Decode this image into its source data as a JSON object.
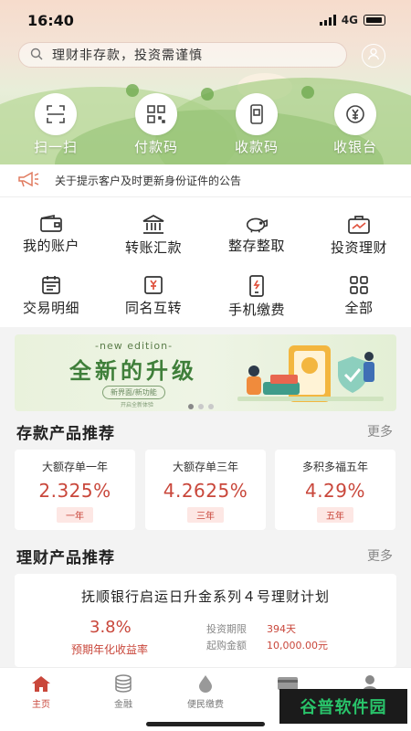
{
  "status_bar": {
    "time": "16:40",
    "network": "4G"
  },
  "search": {
    "placeholder": "理财非存款，投资需谨慎"
  },
  "quick_actions": [
    {
      "label": "扫一扫",
      "icon": "scan-icon"
    },
    {
      "label": "付款码",
      "icon": "qr-code-icon"
    },
    {
      "label": "收款码",
      "icon": "receive-code-icon"
    },
    {
      "label": "收银台",
      "icon": "cashier-icon"
    }
  ],
  "notice": {
    "text": "关于提示客户及时更新身份证件的公告",
    "icon": "megaphone-icon"
  },
  "menu": [
    {
      "label": "我的账户",
      "icon": "wallet-icon"
    },
    {
      "label": "转账汇款",
      "icon": "bank-icon"
    },
    {
      "label": "整存整取",
      "icon": "piggy-bank-icon"
    },
    {
      "label": "投资理财",
      "icon": "investment-chart-icon"
    },
    {
      "label": "交易明细",
      "icon": "calendar-icon"
    },
    {
      "label": "同名互转",
      "icon": "yen-card-icon"
    },
    {
      "label": "手机缴费",
      "icon": "phone-icon"
    },
    {
      "label": "全部",
      "icon": "grid-icon"
    }
  ],
  "banner": {
    "edition": "-new edition-",
    "headline": "全新的升级",
    "sub": "新界面/新功能",
    "sub2": "开启全新体验"
  },
  "deposit_section": {
    "title": "存款产品推荐",
    "more": "更多",
    "cards": [
      {
        "name": "大额存单一年",
        "rate": "2.325%",
        "term": "一年"
      },
      {
        "name": "大额存单三年",
        "rate": "4.2625%",
        "term": "三年"
      },
      {
        "name": "多积多福五年",
        "rate": "4.29%",
        "term": "五年"
      }
    ]
  },
  "wealth_section": {
    "title": "理财产品推荐",
    "more": "更多",
    "product": {
      "name": "抚顺银行启运日升金系列４号理财计划",
      "rate": "3.8%",
      "rate_label": "预期年化收益率",
      "period_label": "投资期限",
      "period_value": "394天",
      "min_label": "起购金额",
      "min_value": "10,000.00元"
    }
  },
  "tabbar": [
    {
      "label": "主页",
      "icon": "home-icon",
      "active": true
    },
    {
      "label": "金融",
      "icon": "coins-icon",
      "active": false
    },
    {
      "label": "便民缴费",
      "icon": "water-drop-icon",
      "active": false
    },
    {
      "label": "信",
      "icon": "card-icon",
      "active": false
    },
    {
      "label": "",
      "icon": "user-icon",
      "active": false
    }
  ],
  "watermark": {
    "text": "谷普软件园"
  },
  "colors": {
    "accent": "#c9473b",
    "banner_green": "#3f7f3a",
    "watermark_green": "#29c46a"
  }
}
